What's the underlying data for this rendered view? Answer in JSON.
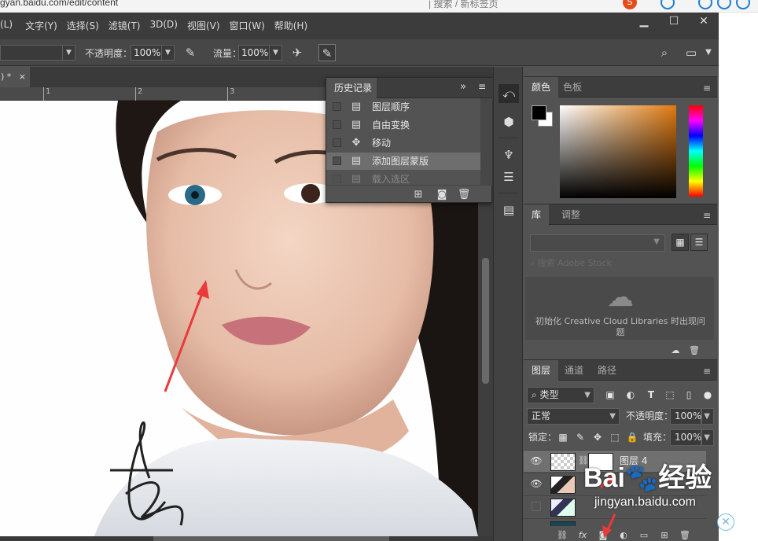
{
  "browser": {
    "url_fragment": "gyan.baidu.com/edit/content",
    "middle_text": "| 搜索 / 新标签页",
    "sogou_badge": "S"
  },
  "menu": {
    "items": [
      "(L)",
      "文字(Y)",
      "选择(S)",
      "滤镜(T)",
      "3D(D)",
      "视图(V)",
      "窗口(W)",
      "帮助(H)"
    ]
  },
  "window_buttons": {
    "minimize": "▁",
    "maximize": "☐",
    "close": "✕"
  },
  "options": {
    "opacity_label": "不透明度：",
    "opacity_value": "100%",
    "flow_label": "流量：",
    "flow_value": "100%"
  },
  "document": {
    "tab_label": ") *",
    "tab_close": "×",
    "ruler_ticks": [
      "1",
      "2",
      "3"
    ]
  },
  "history": {
    "title": "历史记录",
    "expand": "»",
    "menu": "≡",
    "rows": [
      {
        "label": "图层顺序",
        "icon": "▤"
      },
      {
        "label": "自由变换",
        "icon": "▤"
      },
      {
        "label": "移动",
        "icon": "✥"
      },
      {
        "label": "添加图层蒙版",
        "icon": "▤"
      },
      {
        "label": "载入选区",
        "icon": "▤"
      }
    ]
  },
  "panels": {
    "color_tabs": [
      "颜色",
      "色板"
    ],
    "library_tabs": [
      "库",
      "调整"
    ],
    "library_search_placeholder": "搜索 Adobe Stock",
    "library_message": "初始化 Creative Cloud Libraries 时出现问题",
    "layers_tabs": [
      "图层",
      "通道",
      "路径"
    ],
    "filter_kind": "类型",
    "blend_mode": "正常",
    "opacity_label": "不透明度：",
    "opacity_value": "100%",
    "lock_label": "锁定：",
    "fill_label": "填充：",
    "fill_value": "100%",
    "layers": [
      {
        "name": "图层 4",
        "visible": true,
        "selected": true
      },
      {
        "name": "",
        "visible": true,
        "selected": false
      },
      {
        "name": "",
        "visible": false,
        "selected": false
      },
      {
        "name": "",
        "visible": false,
        "selected": false
      }
    ],
    "layer_foot_fx": "fx"
  },
  "watermark": {
    "logo": "Bai🐾经验",
    "url": "jingyan.baidu.com"
  },
  "colors": {
    "ps_bg": "#535353",
    "panel_dark": "#3d3d3d",
    "arrow_red": "#ea3a3a"
  }
}
